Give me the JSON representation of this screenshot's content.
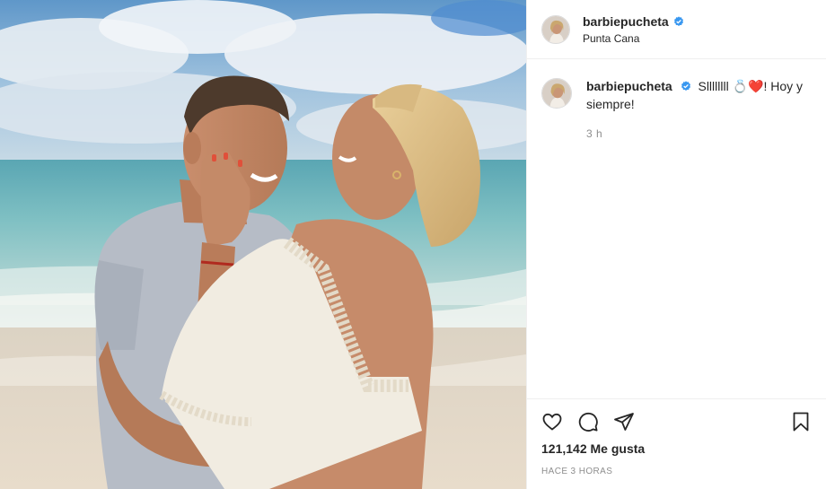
{
  "post": {
    "username": "barbiepucheta",
    "location": "Punta Cana",
    "caption": "Sllllllll 💍❤️! Hoy y siempre!",
    "time_ago": "3 h",
    "likes": "121,142 Me gusta",
    "date": "HACE 3 HORAS"
  },
  "icons": {
    "like": "heart-icon",
    "comment": "comment-bubble-icon",
    "share": "paper-plane-icon",
    "save": "bookmark-icon",
    "verified": "verified-badge-icon"
  },
  "colors": {
    "verified": "#3897f0",
    "secondary_text": "#8e8e8e",
    "divider": "#efefef"
  }
}
